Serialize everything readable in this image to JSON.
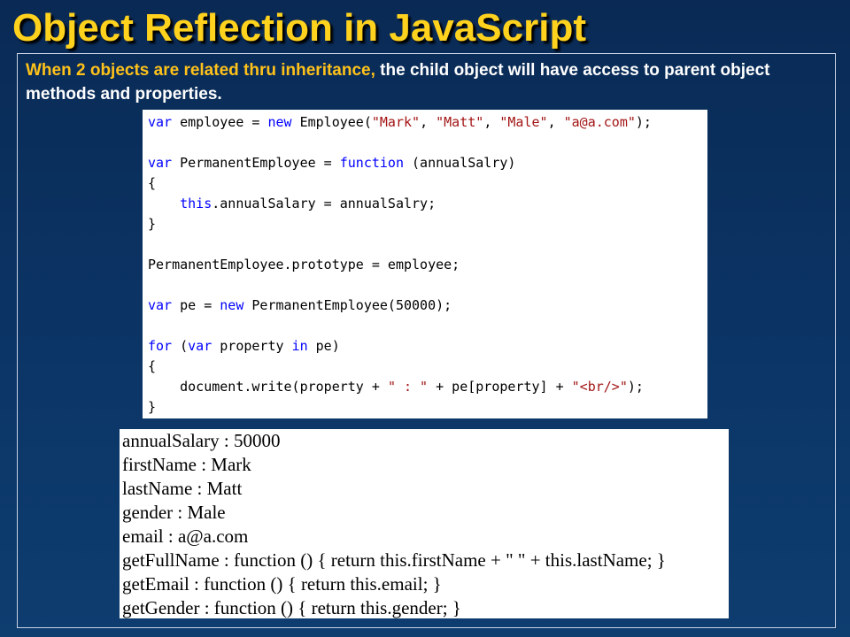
{
  "slide": {
    "title": "Object Reflection in JavaScript",
    "intro": {
      "highlight": "When 2 objects are related thru inheritance,",
      "rest": " the child object will have access to parent object methods and properties."
    }
  },
  "code_lines": [
    [
      {
        "t": "var",
        "c": "kw"
      },
      {
        "t": " employee = "
      },
      {
        "t": "new",
        "c": "kw"
      },
      {
        "t": " Employee("
      },
      {
        "t": "\"Mark\"",
        "c": "str"
      },
      {
        "t": ", "
      },
      {
        "t": "\"Matt\"",
        "c": "str"
      },
      {
        "t": ", "
      },
      {
        "t": "\"Male\"",
        "c": "str"
      },
      {
        "t": ", "
      },
      {
        "t": "\"a@a.com\"",
        "c": "str"
      },
      {
        "t": ");"
      }
    ],
    [],
    [
      {
        "t": "var",
        "c": "kw"
      },
      {
        "t": " PermanentEmployee = "
      },
      {
        "t": "function",
        "c": "kw"
      },
      {
        "t": " (annualSalry)"
      }
    ],
    [
      {
        "t": "{"
      }
    ],
    [
      {
        "t": "    "
      },
      {
        "t": "this",
        "c": "kw"
      },
      {
        "t": ".annualSalary = annualSalry;"
      }
    ],
    [
      {
        "t": "}"
      }
    ],
    [],
    [
      {
        "t": "PermanentEmployee.prototype = employee;"
      }
    ],
    [],
    [
      {
        "t": "var",
        "c": "kw"
      },
      {
        "t": " pe = "
      },
      {
        "t": "new",
        "c": "kw"
      },
      {
        "t": " PermanentEmployee(50000);"
      }
    ],
    [],
    [
      {
        "t": "for",
        "c": "kw"
      },
      {
        "t": " ("
      },
      {
        "t": "var",
        "c": "kw"
      },
      {
        "t": " property "
      },
      {
        "t": "in",
        "c": "kw"
      },
      {
        "t": " pe)"
      }
    ],
    [
      {
        "t": "{"
      }
    ],
    [
      {
        "t": "    document.write(property + "
      },
      {
        "t": "\" : \"",
        "c": "str"
      },
      {
        "t": " + pe[property] + "
      },
      {
        "t": "\"<br/>\"",
        "c": "str"
      },
      {
        "t": ");"
      }
    ],
    [
      {
        "t": "}"
      }
    ]
  ],
  "output_lines": [
    "annualSalary : 50000",
    "firstName : Mark",
    "lastName : Matt",
    "gender : Male",
    "email : a@a.com",
    "getFullName : function () { return this.firstName + \" \" + this.lastName; }",
    "getEmail : function () { return this.email; }",
    "getGender : function () { return this.gender; }"
  ],
  "colors": {
    "title": "#ffd21e",
    "highlight": "#ffc21a",
    "keyword": "#0000ff",
    "string": "#a31515",
    "background": "#0b3566"
  }
}
